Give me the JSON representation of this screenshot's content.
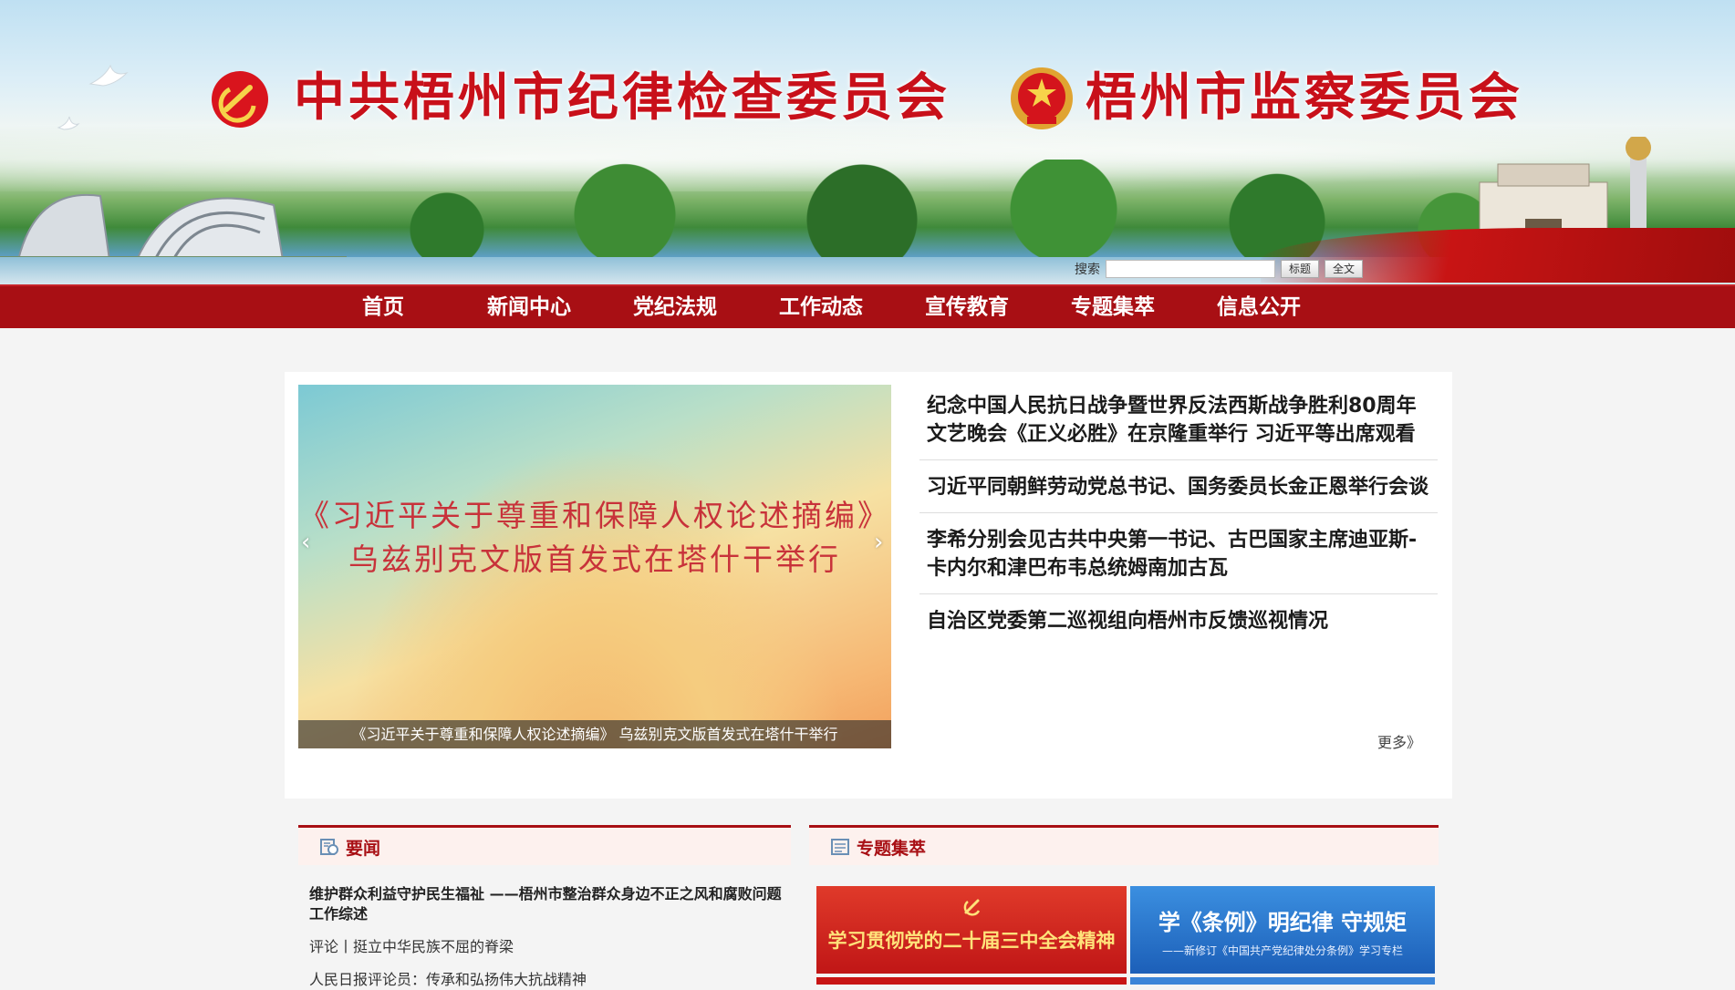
{
  "header": {
    "title_left": "中共梧州市纪律检查委员会",
    "title_right": "梧州市监察委员会",
    "party_emblem_icon": "party-emblem-icon",
    "state_emblem_icon": "national-emblem-icon",
    "accent_color": "#c8101a"
  },
  "search": {
    "label": "搜索",
    "value": "",
    "placeholder": "",
    "btn_title": "标题",
    "btn_fulltext": "全文"
  },
  "nav": {
    "items": [
      "首页",
      "新闻中心",
      "党纪法规",
      "工作动态",
      "宣传教育",
      "专题集萃",
      "信息公开"
    ],
    "background": "#a80f14"
  },
  "slider": {
    "title_line1": "《习近平关于尊重和保障人权论述摘编》",
    "title_line2": "乌兹别克文版首发式在塔什干举行",
    "caption": "《习近平关于尊重和保障人权论述摘编》 乌兹别克文版首发式在塔什干举行",
    "prev_icon": "chevron-left-icon",
    "next_icon": "chevron-right-icon"
  },
  "headlines": [
    "纪念中国人民抗日战争暨世界反法西斯战争胜利80周年文艺晚会《正义必胜》在京隆重举行 习近平等出席观看",
    "习近平同朝鲜劳动党总书记、国务委员长金正恩举行会谈",
    "李希分别会见古共中央第一书记、古巴国家主席迪亚斯-卡内尔和津巴布韦总统姆南加古瓦",
    "自治区党委第二巡视组向梧州市反馈巡视情况"
  ],
  "more_label": "更多》",
  "yaowen": {
    "title": "要闻",
    "icon": "news-icon",
    "main": "维护群众利益守护民生福祉 ——梧州市整治群众身边不正之风和腐败问题工作综述",
    "items": [
      "评论丨挺立中华民族不屈的脊梁",
      "人民日报评论员：传承和弘扬伟大抗战精神"
    ]
  },
  "zhuanti": {
    "title": "专题集萃",
    "icon": "topics-icon",
    "banner_a": "学习贯彻党的二十届三中全会精神",
    "banner_b": "学《条例》明纪律 守规矩",
    "banner_b_sub": "——新修订《中国共产党纪律处分条例》学习专栏"
  }
}
